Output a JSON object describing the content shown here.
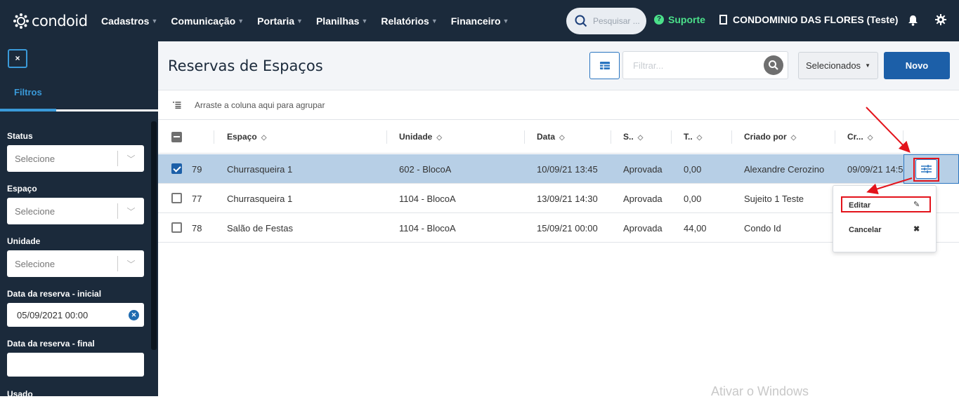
{
  "app": {
    "logo": "condoid"
  },
  "nav": [
    {
      "label": "Cadastros"
    },
    {
      "label": "Comunicação"
    },
    {
      "label": "Portaria"
    },
    {
      "label": "Planilhas"
    },
    {
      "label": "Relatórios"
    },
    {
      "label": "Financeiro"
    }
  ],
  "topbar": {
    "search_placeholder": "Pesquisar ...",
    "support_label": "Suporte",
    "condo_name": "CONDOMINIO DAS FLORES (Teste)"
  },
  "sidebar": {
    "close_label": "×",
    "tab_label": "Filtros",
    "filters": {
      "status_label": "Status",
      "status_value": "Selecione",
      "espaco_label": "Espaço",
      "espaco_value": "Selecione",
      "unidade_label": "Unidade",
      "unidade_value": "Selecione",
      "data_inicial_label": "Data da reserva - inicial",
      "data_inicial_value": "05/09/2021 00:00",
      "data_final_label": "Data da reserva - final",
      "data_final_value": "",
      "usado_label": "Usado"
    }
  },
  "page": {
    "title": "Reservas de Espaços",
    "filter_placeholder": "Filtrar...",
    "selecionados_label": "Selecionados",
    "novo_label": "Novo",
    "group_hint": "Arraste a coluna aqui para agrupar"
  },
  "table": {
    "columns": {
      "espaco": "Espaço",
      "unidade": "Unidade",
      "data": "Data",
      "status": "S..",
      "total": "T..",
      "criado_por": "Criado por",
      "criado_em": "Cr..."
    },
    "rows": [
      {
        "id": "79",
        "espaco": "Churrasqueira 1",
        "unidade": "602 - BlocoA",
        "data": "10/09/21 13:45",
        "status": "Aprovada",
        "total": "0,00",
        "criado_por": "Alexandre Cerozino",
        "criado_em": "09/09/21 14:5",
        "selected": true
      },
      {
        "id": "77",
        "espaco": "Churrasqueira 1",
        "unidade": "1104 - BlocoA",
        "data": "13/09/21 14:30",
        "status": "Aprovada",
        "total": "0,00",
        "criado_por": "Sujeito 1 Teste",
        "criado_em": "",
        "selected": false
      },
      {
        "id": "78",
        "espaco": "Salão de Festas",
        "unidade": "1104 - BlocoA",
        "data": "15/09/21 00:00",
        "status": "Aprovada",
        "total": "44,00",
        "criado_por": "Condo Id",
        "criado_em": "",
        "selected": false
      }
    ]
  },
  "action_menu": {
    "edit_label": "Editar",
    "cancel_label": "Cancelar"
  },
  "watermark": "Ativar o Windows",
  "colors": {
    "topbar": "#1b2a3b",
    "accent": "#1c5fa8",
    "selected_row": "#b7cfe6",
    "support": "#4be08a",
    "annotation": "#e3131b"
  }
}
